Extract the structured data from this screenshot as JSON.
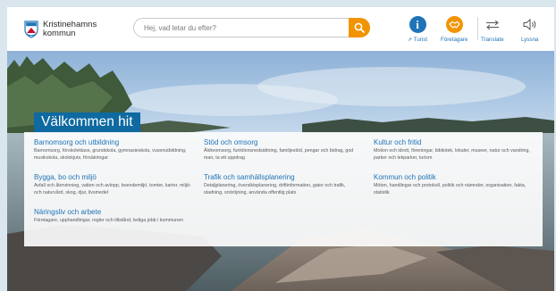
{
  "header": {
    "logo_line1": "Kristinehamns",
    "logo_line2": "kommun",
    "search_placeholder": "Hej, vad letar du efter?",
    "nav": {
      "turist": "Turist",
      "turist_icon": "info-icon",
      "foretagare": "Företagare",
      "foretagare_icon": "handshake-icon",
      "translate": "Translate",
      "translate_icon": "translate-arrows-icon",
      "lyssna": "Lyssna",
      "lyssna_icon": "speaker-icon"
    }
  },
  "hero": {
    "welcome": "Välkommen hit",
    "categories": [
      {
        "title": "Barnomsorg och utbildning",
        "desc": "Barnomsorg, förskoleklass, grundskola, gymnasieskola, vuxenutbildning, musikskola, skolskjuts, försäkringar"
      },
      {
        "title": "Bygga, bo och miljö",
        "desc": "Avfall och återvinning, vatten och avlopp, boendemiljö, tomter, kartor, miljö- och naturvård, skog, djur, livsmedel"
      },
      {
        "title": "Näringsliv och arbete",
        "desc": "Företagare, upphandlingar, regler och tillstånd, lediga jobb i kommunen"
      },
      {
        "title": "Stöd och omsorg",
        "desc": "Äldreomsorg, funktionsnedsättning, familjestöd, pengar och bidrag, god man, ta ett uppdrag"
      },
      {
        "title": "Trafik och samhällsplanering",
        "desc": "Detaljplanering, översiktsplanering, driftinformation, gator och trafik, stadning, snöröjning, använda offentlig plats"
      },
      {
        "title": "Kultur och fritid",
        "desc": "Motion och idrott, föreningar, bibliotek, lokaler, museer, natur och vandring, parker och lekparker, turism"
      },
      {
        "title": "Kommun och politik",
        "desc": "Möten, handlingar och protokoll, politik och nämnder, organisation, fakta, statistik"
      }
    ]
  },
  "colors": {
    "brand_blue": "#1f73b7",
    "accent_orange": "#f29400",
    "welcome_bg": "#0e6aa0"
  }
}
